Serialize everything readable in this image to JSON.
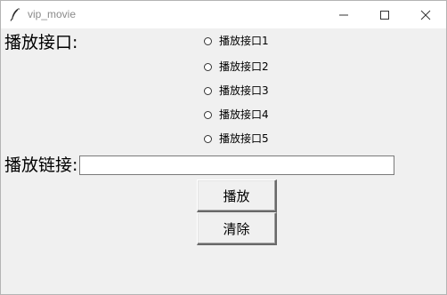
{
  "window": {
    "title": "vip_movie"
  },
  "form": {
    "interface_label": "播放接口:",
    "link_label": "播放链接:",
    "link_value": "",
    "interfaces": [
      {
        "label": "播放接口1",
        "selected": false
      },
      {
        "label": "播放接口2",
        "selected": false
      },
      {
        "label": "播放接口3",
        "selected": false
      },
      {
        "label": "播放接口4",
        "selected": false
      },
      {
        "label": "播放接口5",
        "selected": false
      }
    ]
  },
  "buttons": {
    "play_label": "播放",
    "clear_label": "清除"
  },
  "icons": {
    "app": "feather-icon",
    "minimize": "minimize-icon",
    "maximize": "maximize-icon",
    "close": "close-icon"
  },
  "colors": {
    "window_background": "#f0f0f0",
    "titlebar_background": "#ffffff",
    "title_text": "#8a8a8a"
  }
}
